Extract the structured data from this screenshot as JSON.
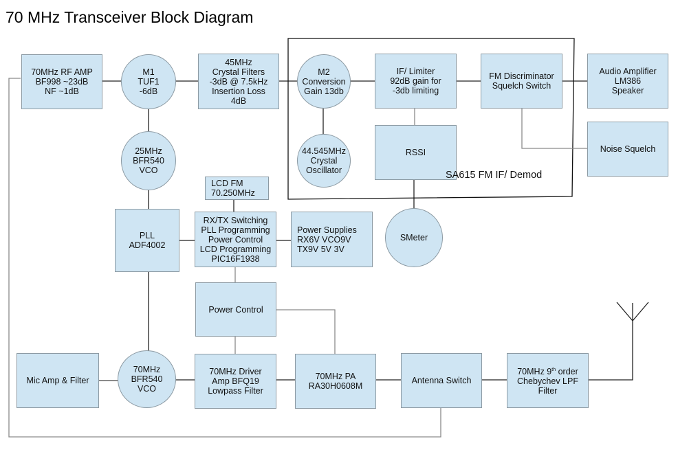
{
  "title": "70 MHz Transceiver Block Diagram",
  "colors": {
    "block_fill": "#cfe5f3",
    "block_border": "#8c9aa3",
    "signal_wire": "#222222",
    "control_wire": "#999999"
  },
  "enclosure": {
    "label": "SA615 FM IF/ Demod"
  },
  "blocks": {
    "rf_amp": "70MHz RF AMP\nBF998 ~23dB\nNF ~1dB",
    "m1": "M1\nTUF1\n-6dB",
    "crystal_filters": "45MHz\nCrystal Filters\n-3dB @ 7.5kHz\nInsertion Loss\n4dB",
    "m2": "M2\nConversion\nGain 13db",
    "if_limiter": "IF/ Limiter\n92dB gain for\n-3db limiting",
    "fm_discriminator": "FM Discriminator\nSquelch Switch",
    "audio_amp": "Audio Amplifier\nLM386\nSpeaker",
    "noise_squelch": "Noise Squelch",
    "crystal_osc": "44.545MHz\nCrystal\nOscillator",
    "rssi": "RSSI",
    "vco_25": "25MHz\nBFR540\nVCO",
    "lcd": "LCD        FM\n70.250MHz",
    "pll": "PLL\nADF4002",
    "controller": "RX/TX Switching\nPLL Programming\nPower Control\nLCD Programming\nPIC16F1938",
    "power_supplies": "Power Supplies\nRX6V VCO9V\nTX9V 5V 3V",
    "smeter": "SMeter",
    "power_control": "Power Control",
    "mic_amp": "Mic Amp & Filter",
    "vco_70": "70MHz\nBFR540\nVCO",
    "driver": "70MHz Driver\nAmp BFQ19\nLowpass Filter",
    "pa": "70MHz PA\nRA30H0608M",
    "antenna_switch": "Antenna Switch",
    "lpf_line1": "70MHz 9",
    "lpf_sup": "th",
    "lpf_rest": " order\nChebychev LPF\nFilter"
  }
}
